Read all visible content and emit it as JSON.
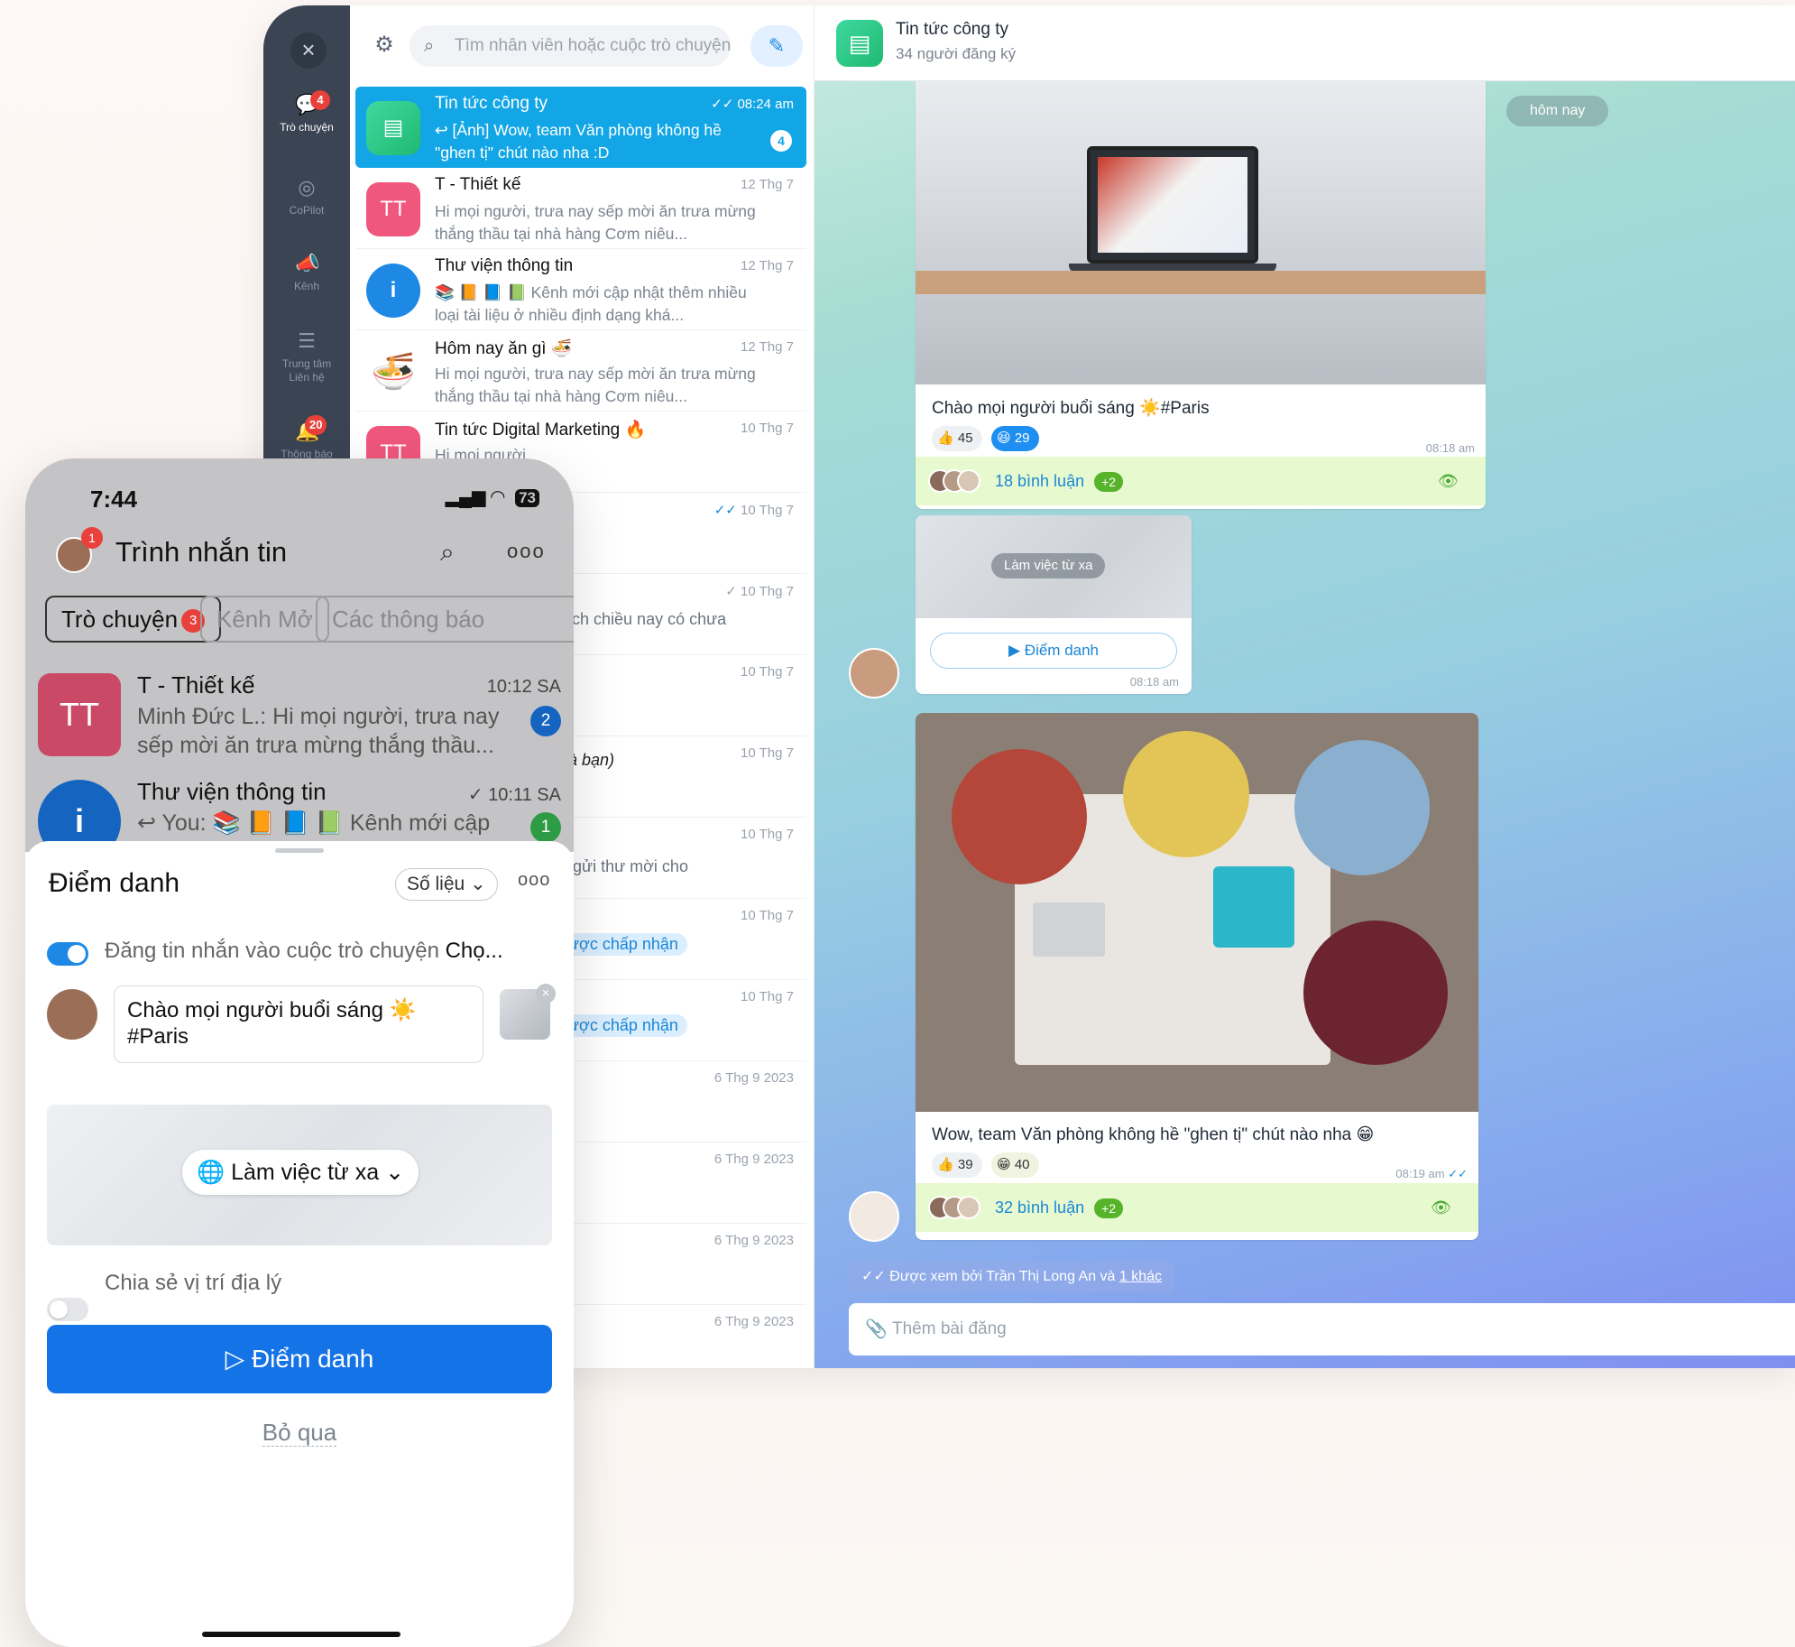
{
  "rail": {
    "items": [
      {
        "label": "Trò chuyện",
        "badge": "4",
        "icon": "chat-icon"
      },
      {
        "label": "CoPilot",
        "icon": "copilot-icon"
      },
      {
        "label": "Kênh",
        "icon": "megaphone-icon"
      },
      {
        "label": "Trung tâm Liên hệ",
        "icon": "contact-center-icon"
      },
      {
        "label": "Thông báo",
        "badge": "20",
        "icon": "bell-icon"
      }
    ]
  },
  "list": {
    "search_placeholder": "Tìm nhân viên hoặc cuộc trò chuyện",
    "conversations": [
      {
        "name": "Tin tức công ty",
        "time": "08:24 am",
        "preview": "[Ảnh] Wow, team Văn phòng không hề \"ghen tị\" chút nào nha :D",
        "unread": "4"
      },
      {
        "name": "T - Thiết kế",
        "avatar": "TT",
        "time": "12 Thg 7",
        "preview": "Hi mọi người, trưa nay sếp mời ăn trưa mừng thắng thầu tại nhà hàng Cơm niêu..."
      },
      {
        "name": "Thư viện thông tin",
        "avatar": "i",
        "time": "12 Thg 7",
        "preview": "📚 📙 📘 📗 Kênh mới cập nhật thêm nhiều loại tài liệu ở nhiều định dạng khá..."
      },
      {
        "name": "Hôm nay ăn gì 🍜",
        "time": "12 Thg 7",
        "preview": "Hi mọi người, trưa nay sếp mời ăn trưa mừng thắng thầu tại nhà hàng Cơm niêu..."
      },
      {
        "name": "Tin tức Digital Marketing 🔥",
        "avatar": "TT",
        "time": "10 Thg 7",
        "preview": "Hi mọi người"
      }
    ],
    "partial_rows": [
      {
        "time": "10 Thg 7",
        "text": ""
      },
      {
        "time": "10 Thg 7",
        "text": "ạch chiều nay có chưa"
      },
      {
        "time": "10 Thg 7",
        "text": ""
      },
      {
        "time": "10 Thg 7",
        "text": "(là bạn)"
      },
      {
        "time": "10 Thg 7",
        "text": "g",
        "text2": "ã gửi thư mời cho"
      },
      {
        "time": "10 Thg 7",
        "pill": "ược chấp nhận"
      },
      {
        "time": "10 Thg 7",
        "pill": "ược chấp nhận"
      },
      {
        "time": "6 Thg 9 2023",
        "text": ""
      },
      {
        "time": "6 Thg 9 2023",
        "text": "n"
      },
      {
        "time": "6 Thg 9 2023",
        "text": ""
      },
      {
        "time": "6 Thg 9 2023",
        "text": ""
      }
    ]
  },
  "chat": {
    "title": "Tin tức công ty",
    "subtitle": "34 người đăng ký",
    "day_label": "hôm nay",
    "post1": {
      "caption": "Chào mọi người buổi sáng ☀️#Paris",
      "like": "45",
      "haha": "29",
      "time": "08:18 am",
      "comments": "18 bình luận",
      "more": "+2"
    },
    "checkin": {
      "location": "Làm việc từ xa",
      "button": "Điểm danh",
      "time": "08:18 am"
    },
    "post2": {
      "caption": "Wow, team Văn phòng không hề \"ghen tị\" chút nào nha 😁",
      "like": "39",
      "grin": "40",
      "time": "08:19 am",
      "comments": "32 bình luận",
      "more": "+2"
    },
    "seen_by": "Được xem bởi Trần Thị Long An và",
    "seen_more": "1 khác",
    "composer_placeholder": "Thêm bài đăng"
  },
  "phone": {
    "time": "7:44",
    "battery": "73",
    "title": "Trình nhắn tin",
    "avatar_badge": "1",
    "tabs": [
      {
        "label": "Trò chuyện",
        "badge": "3"
      },
      {
        "label": "Kênh Mở"
      },
      {
        "label": "Các thông báo"
      }
    ],
    "conversations": [
      {
        "name": "T - Thiết kế",
        "avatar": "TT",
        "time": "10:12 SA",
        "preview": "Minh Đức L.: Hi mọi người, trưa nay sếp mời ăn trưa mừng thắng thầu...",
        "unread": "2"
      },
      {
        "name": "Thư viện thông tin",
        "avatar": "i",
        "time": "10:11 SA",
        "preview": "You: 📚 📙 📘 📗 Kênh mới cập nhật",
        "unread": "1"
      }
    ],
    "sheet": {
      "title": "Điểm danh",
      "metric_select": "Số liệu",
      "post_toggle_label": "Đăng tin nhắn vào cuộc trò chuyện",
      "post_toggle_target": "Chọ...",
      "message": "Chào mọi người buổi sáng ☀️ #Paris",
      "location": "Làm việc từ xa",
      "share_location_label": "Chia sẻ vị trí địa lý",
      "primary_button": "Điểm danh",
      "skip_button": "Bỏ qua"
    }
  },
  "colors": {
    "accent": "#12a6e6",
    "primary_button": "#1473e6",
    "danger": "#e8403a",
    "comment_bar": "#e7f9cf"
  }
}
